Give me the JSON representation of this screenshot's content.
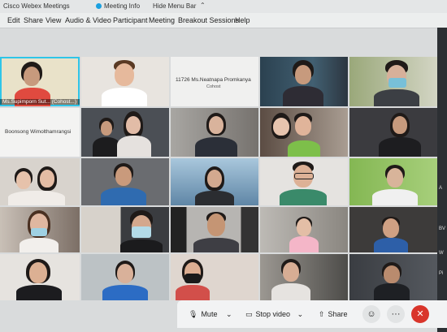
{
  "titlebar": {
    "app_name": "Cisco Webex Meetings",
    "meeting_info": "Meeting Info",
    "hide_menu_bar": "Hide Menu Bar"
  },
  "menu": {
    "items": [
      "Edit",
      "Share",
      "View",
      "Audio & Video",
      "Participant",
      "Meeting",
      "Breakout Sessions",
      "Help"
    ]
  },
  "participants": [
    {
      "name": "Ms.Supimporn Sut... (Cohost...)"
    },
    {
      "name": ""
    },
    {
      "name": "11726 Ms.Neatnapa Promkanya",
      "sub": "Cohost"
    },
    {
      "name": ""
    },
    {
      "name": ""
    },
    {
      "name": "Boonsong Wimolthamrangsi"
    }
  ],
  "right_edge": [
    "A",
    "BV",
    "W",
    "Pi"
  ],
  "controls": {
    "mute": "Mute",
    "stop_video": "Stop video",
    "share": "Share",
    "leave_color": "#d9352b"
  },
  "colors": {
    "accent": "#2fc5e8"
  }
}
